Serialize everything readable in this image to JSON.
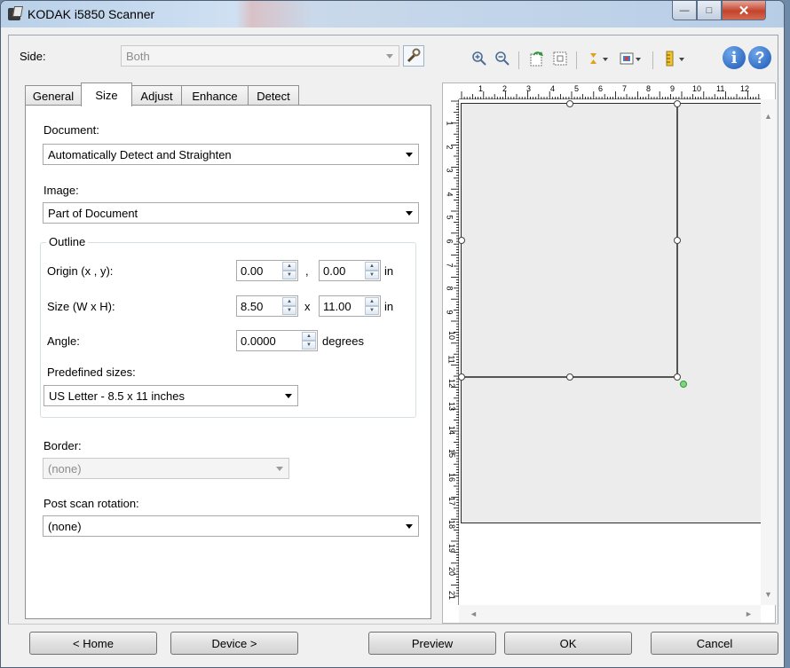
{
  "window": {
    "title": "KODAK i5850 Scanner",
    "minimize_glyph": "—",
    "maximize_glyph": "□",
    "close_glyph": "✕"
  },
  "side": {
    "label": "Side:",
    "value": "Both"
  },
  "tabs": [
    {
      "label": "General"
    },
    {
      "label": "Size"
    },
    {
      "label": "Adjust"
    },
    {
      "label": "Enhance"
    },
    {
      "label": "Detect"
    }
  ],
  "size_tab": {
    "document_label": "Document:",
    "document_value": "Automatically Detect and Straighten",
    "image_label": "Image:",
    "image_value": "Part of Document",
    "outline_label": "Outline",
    "origin_label": "Origin (x , y):",
    "origin_x": "0.00",
    "origin_sep": ",",
    "origin_y": "0.00",
    "origin_unit": "in",
    "size_label": "Size (W x H):",
    "size_w": "8.50",
    "size_sep": "x",
    "size_h": "11.00",
    "size_unit": "in",
    "angle_label": "Angle:",
    "angle_value": "0.0000",
    "angle_unit": "degrees",
    "predefined_label": "Predefined sizes:",
    "predefined_value": "US Letter - 8.5 x 11 inches",
    "border_label": "Border:",
    "border_value": "(none)",
    "rotation_label": "Post scan rotation:",
    "rotation_value": "(none)"
  },
  "toolbar": {
    "zoom_in_icon": "zoom-in-icon",
    "zoom_out_icon": "zoom-out-icon",
    "rotate_icon": "rotate-icon",
    "fit_icon": "fit-page-icon",
    "flip_icon": "flip-icon",
    "color_icon": "color-mode-icon",
    "ruler_icon": "ruler-icon",
    "info_icon": "info-icon",
    "help_icon": "help-icon",
    "info_glyph": "i",
    "help_glyph": "?"
  },
  "ruler": {
    "h_numbers": [
      "1",
      "2",
      "3",
      "4",
      "5",
      "6",
      "7",
      "8",
      "9",
      "10",
      "11",
      "12"
    ],
    "v_numbers": [
      "1",
      "2",
      "3",
      "4",
      "5",
      "6",
      "7",
      "8",
      "9",
      "10",
      "11",
      "12",
      "13",
      "14",
      "15",
      "16",
      "17",
      "18",
      "19",
      "20",
      "21"
    ]
  },
  "scroll": {
    "up": "▲",
    "down": "▼",
    "left": "◄",
    "right": "►"
  },
  "buttons": {
    "home": "< Home",
    "device": "Device >",
    "preview": "Preview",
    "ok": "OK",
    "cancel": "Cancel"
  }
}
